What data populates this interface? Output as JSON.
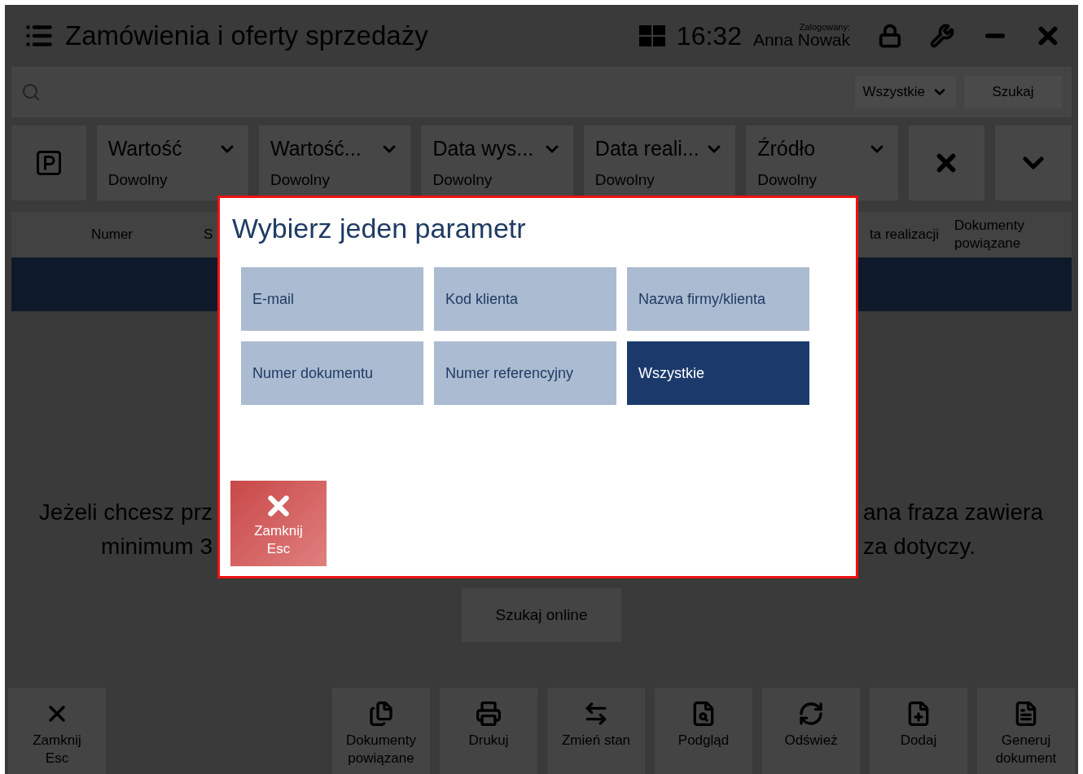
{
  "header": {
    "title": "Zamówienia i oferty sprzedaży",
    "time": "16:32",
    "user_label": "Zalogowany:",
    "user": "Anna Nowak"
  },
  "search": {
    "scope": "Wszystkie",
    "button": "Szukaj"
  },
  "filters": [
    {
      "label": "Wartość",
      "value": "Dowolny"
    },
    {
      "label": "Wartość...",
      "value": "Dowolny"
    },
    {
      "label": "Data wys...",
      "value": "Dowolny"
    },
    {
      "label": "Data reali...",
      "value": "Dowolny"
    },
    {
      "label": "Źródło",
      "value": "Dowolny"
    }
  ],
  "columns": [
    "Numer",
    "S",
    "ta realizacji",
    "Dokumenty powiązane"
  ],
  "hint": [
    {
      "left": "Jeżeli chcesz prz",
      "right": "ana fraza zawiera"
    },
    {
      "left": "minimum 3",
      "right": "za dotyczy."
    }
  ],
  "online_button": "Szukaj online",
  "toolbar": [
    {
      "label": "Zamknij",
      "sub": "Esc"
    },
    {
      "label": "Dokumenty",
      "sub": "powiązane"
    },
    {
      "label": "Drukuj"
    },
    {
      "label": "Zmień stan"
    },
    {
      "label": "Podgląd"
    },
    {
      "label": "Odśwież"
    },
    {
      "label": "Dodaj"
    },
    {
      "label": "Generuj",
      "sub": "dokument"
    }
  ],
  "dialog": {
    "title": "Wybierz jeden parametr",
    "options": [
      {
        "label": "E-mail",
        "selected": false
      },
      {
        "label": "Kod klienta",
        "selected": false
      },
      {
        "label": "Nazwa firmy/klienta",
        "selected": false
      },
      {
        "label": "Numer dokumentu",
        "selected": false
      },
      {
        "label": "Numer referencyjny",
        "selected": false
      },
      {
        "label": "Wszystkie",
        "selected": true
      }
    ],
    "close": {
      "label": "Zamknij",
      "key": "Esc"
    }
  }
}
